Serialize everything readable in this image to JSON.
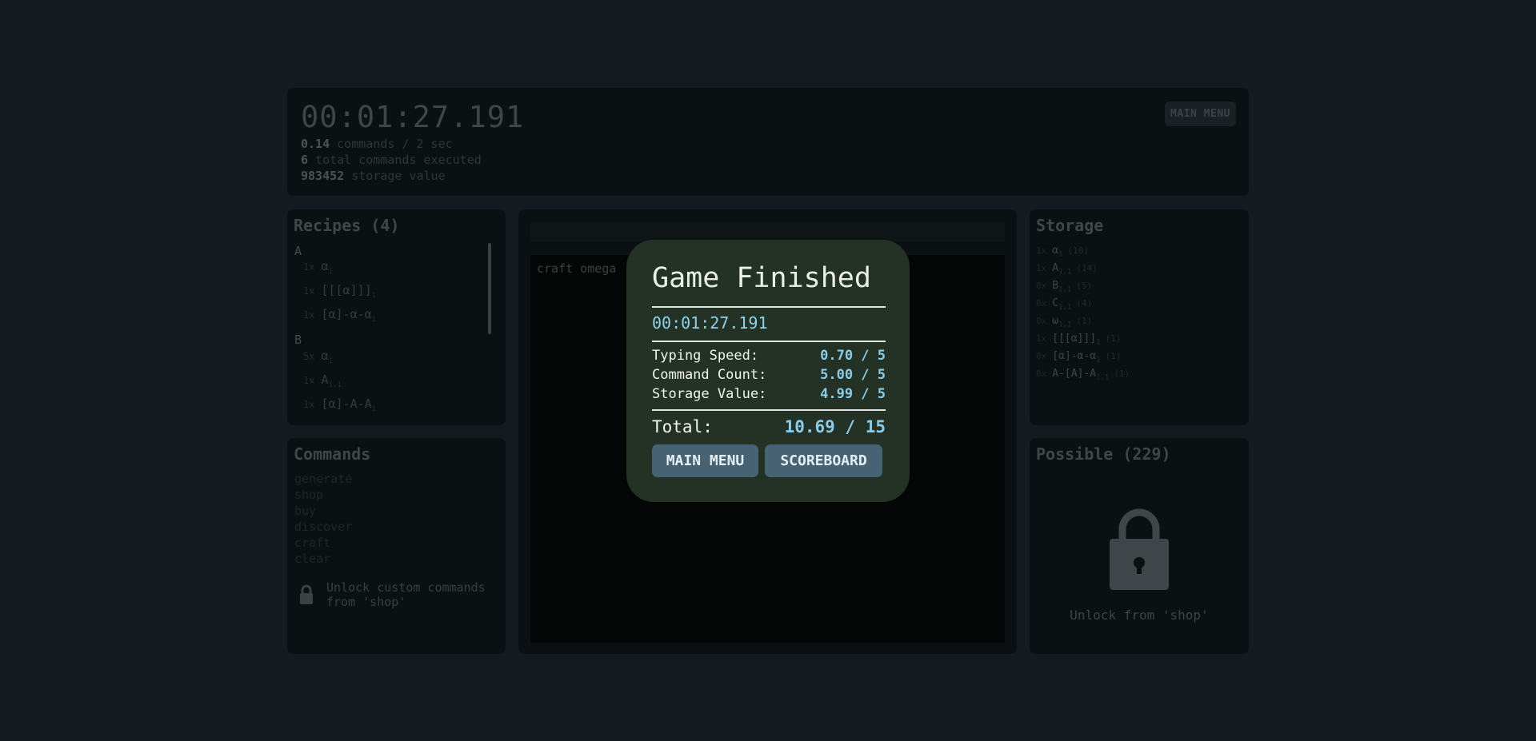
{
  "header": {
    "timer": "00:01:27.191",
    "stats": [
      {
        "value": "0.14",
        "label": "commands / 2 sec"
      },
      {
        "value": "6",
        "label": "total commands executed"
      },
      {
        "value": "983452",
        "label": "storage value"
      }
    ],
    "main_menu_label": "MAIN MENU"
  },
  "recipes": {
    "title": "Recipes (4)",
    "groups": [
      {
        "name": "A",
        "items": [
          {
            "num": "1x",
            "text": "α",
            "sub": "1"
          },
          {
            "num": "1x",
            "text": "[[[α]]]",
            "sub": "1"
          },
          {
            "num": "1x",
            "text": "[α]-α-α",
            "sub": "1"
          }
        ]
      },
      {
        "name": "B",
        "items": [
          {
            "num": "5x",
            "text": "α",
            "sub": "1"
          },
          {
            "num": "1x",
            "text": "A",
            "sub": "1,1"
          },
          {
            "num": "1x",
            "text": "[α]-A-A",
            "sub": "1"
          }
        ]
      }
    ]
  },
  "commands": {
    "title": "Commands",
    "items": [
      "generate",
      "shop",
      "buy",
      "discover",
      "craft",
      "clear"
    ],
    "unlock_text": "Unlock custom commands from 'shop'"
  },
  "terminal": {
    "input_value": "",
    "output_line": "craft omega"
  },
  "storage": {
    "title": "Storage",
    "items": [
      {
        "num": "1x",
        "text": "α",
        "sub": "1",
        "count": "(10)"
      },
      {
        "num": "1x",
        "text": "A",
        "sub": "1,1",
        "count": "(14)"
      },
      {
        "num": "0x",
        "text": "B",
        "sub": "1,1",
        "count": "(5)"
      },
      {
        "num": "0x",
        "text": "C",
        "sub": "1,1",
        "count": "(4)"
      },
      {
        "num": "0x",
        "text": "ω",
        "sub": "1,1",
        "count": "(1)"
      },
      {
        "num": "1x",
        "text": "[[[α]]]",
        "sub": "1",
        "count": "(1)"
      },
      {
        "num": "0x",
        "text": "[α]-α-α",
        "sub": "1",
        "count": "(1)"
      },
      {
        "num": "0x",
        "text": "A-[A]-A",
        "sub": "1,1",
        "count": "(1)"
      }
    ]
  },
  "possible": {
    "title": "Possible (229)",
    "unlock_text": "Unlock from 'shop'"
  },
  "modal": {
    "title": "Game Finished",
    "time": "00:01:27.191",
    "scores": [
      {
        "label": "Typing Speed:",
        "value": "0.70 / 5"
      },
      {
        "label": "Command Count:",
        "value": "5.00 / 5"
      },
      {
        "label": "Storage Value:",
        "value": "4.99 / 5"
      }
    ],
    "total_label": "Total:",
    "total_value": "10.69 / 15",
    "main_menu_label": "MAIN MENU",
    "scoreboard_label": "SCOREBOARD"
  },
  "colors": {
    "background": "#131b21",
    "panel": "#0b1012",
    "modal_bg": "#233225",
    "accent_value": "#88cdeb",
    "button_bg": "#476373"
  },
  "icons": {
    "command_lock": "lock-icon",
    "possible_lock": "lock-icon"
  }
}
